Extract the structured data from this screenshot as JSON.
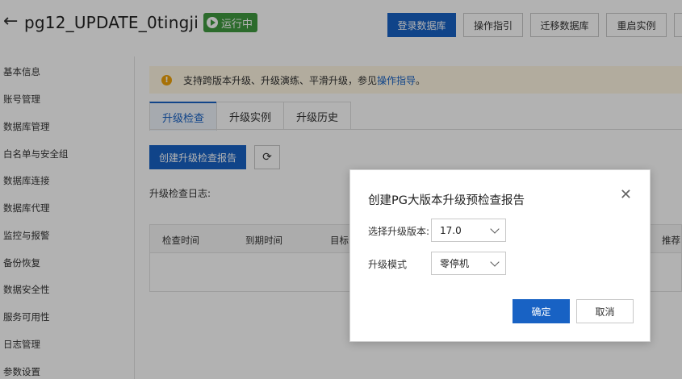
{
  "header": {
    "title": "pg12_UPDATE_0tingji",
    "status": "运行中",
    "buttons": [
      "登录数据库",
      "操作指引",
      "迁移数据库",
      "重启实例"
    ]
  },
  "sidebar": {
    "items": [
      "基本信息",
      "账号管理",
      "数据库管理",
      "白名单与安全组",
      "数据库连接",
      "数据库代理",
      "监控与报警",
      "备份恢复",
      "数据安全性",
      "服务可用性",
      "日志管理",
      "参数设置"
    ]
  },
  "notice": {
    "text": "支持跨版本升级、升级演练、平滑升级，参见",
    "link": "操作指导",
    "suffix": "。"
  },
  "tabs": [
    "升级检查",
    "升级实例",
    "升级历史"
  ],
  "main": {
    "create_button": "创建升级检查报告",
    "log_label": "升级检查日志:",
    "columns": [
      "检查时间",
      "到期时间",
      "目标",
      "推荐"
    ]
  },
  "modal": {
    "title": "创建PG大版本升级预检查报告",
    "version_label": "选择升级版本:",
    "version_value": "17.0",
    "mode_label": "升级模式",
    "mode_value": "零停机",
    "ok": "确定",
    "cancel": "取消"
  }
}
